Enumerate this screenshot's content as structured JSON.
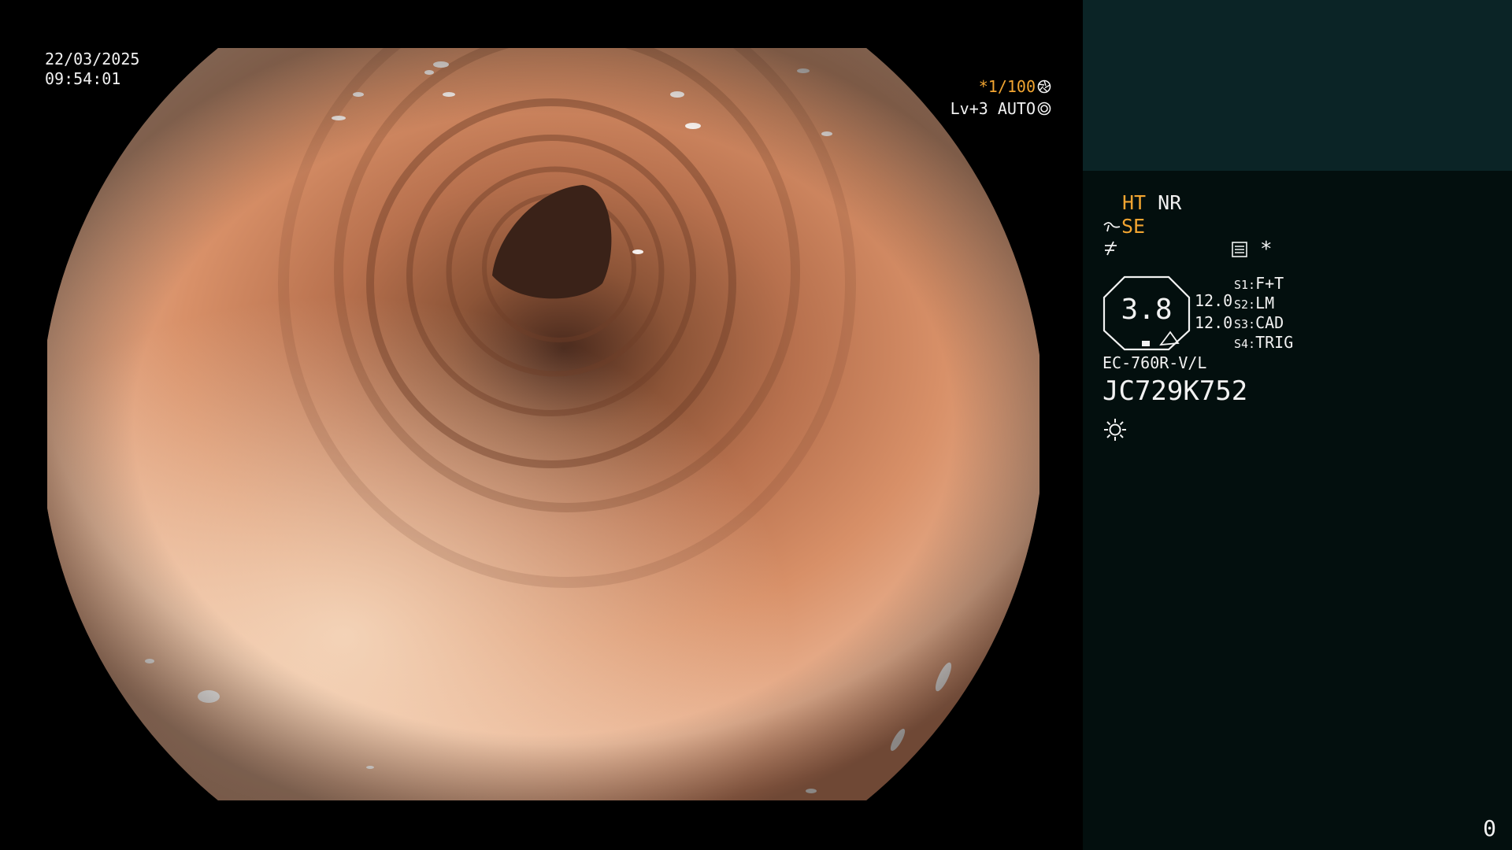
{
  "overlay": {
    "date": "22/03/2025",
    "time": "09:54:01",
    "shutter": "*1/100",
    "shutter_icon": "aperture-icon",
    "level": "Lv+3",
    "iris_mode": "AUTO",
    "iris_icon": "iris-icon"
  },
  "panel": {
    "mode_ht": "HT",
    "mode_nr": "NR",
    "mode_se": "SE",
    "record_icon": "record-list-icon",
    "star": "*",
    "zoom_value": "3.8",
    "value_top": "12.0",
    "value_bottom": "12.0",
    "switches": [
      {
        "key": "S1:",
        "value": "F+T"
      },
      {
        "key": "S2:",
        "value": "LM"
      },
      {
        "key": "S3:",
        "value": "CAD"
      },
      {
        "key": "S4:",
        "value": "TRIG"
      }
    ],
    "scope_model": "EC-760R-V/L",
    "serial": "JC729K752",
    "light_icon": "sun-icon",
    "counter": "0"
  },
  "colors": {
    "accent_orange": "#f2a531",
    "panel_top": "#0b2426",
    "panel_bg": "#030f0e",
    "mucosa": "#d89068",
    "lumen": "#3a2218"
  }
}
